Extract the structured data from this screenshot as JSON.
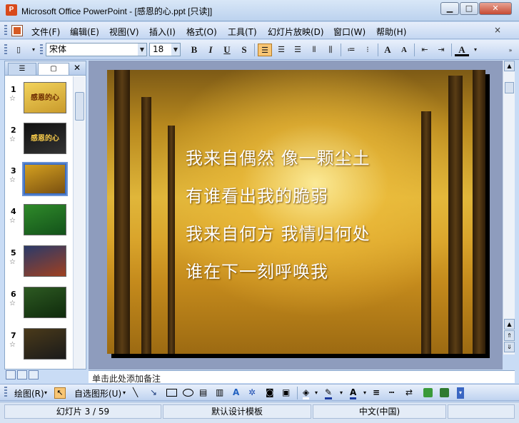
{
  "window": {
    "title": "Microsoft Office PowerPoint - [感恩的心.ppt [只读]]",
    "app_icon": "powerpoint-icon",
    "minimize": "▁",
    "maximize": "□",
    "close": "✕"
  },
  "menubar": {
    "items": [
      "文件(F)",
      "编辑(E)",
      "视图(V)",
      "插入(I)",
      "格式(O)",
      "工具(T)",
      "幻灯片放映(D)",
      "窗口(W)",
      "帮助(H)"
    ],
    "close_doc": "×"
  },
  "toolbar": {
    "font_name": "宋体",
    "font_size": "18",
    "bold": "B",
    "italic": "I",
    "underline": "U",
    "shadow": "S",
    "font_color_label": "A"
  },
  "slides_pane": {
    "thumbnails": [
      {
        "number": "1",
        "text": "感恩的心",
        "colors": [
          "#f2d35c",
          "#c99a2b"
        ]
      },
      {
        "number": "2",
        "text": "感恩的心",
        "colors": [
          "#111111",
          "#333333"
        ]
      },
      {
        "number": "3",
        "text": "",
        "colors": [
          "#d4a020",
          "#7a5010"
        ],
        "selected": true
      },
      {
        "number": "4",
        "text": "",
        "colors": [
          "#2f8a2a",
          "#13521a"
        ]
      },
      {
        "number": "5",
        "text": "",
        "colors": [
          "#2a3a6a",
          "#a04020"
        ]
      },
      {
        "number": "6",
        "text": "",
        "colors": [
          "#2d5a22",
          "#0f2a0c"
        ]
      },
      {
        "number": "7",
        "text": "",
        "colors": [
          "#4a3a1a",
          "#1a1a1a"
        ]
      }
    ]
  },
  "slide": {
    "lines": [
      "我来自偶然 像一颗尘土",
      "有谁看出我的脆弱",
      "我来自何方 我情归何处",
      "谁在下一刻呼唤我"
    ]
  },
  "notes": {
    "placeholder": "单击此处添加备注"
  },
  "drawing_toolbar": {
    "draw_label": "绘图(R)",
    "autoshape_label": "自选图形(U)",
    "font_color_label": "A"
  },
  "statusbar": {
    "slide_info": "幻灯片 3 / 59",
    "template": "默认设计模板",
    "language": "中文(中国)"
  }
}
